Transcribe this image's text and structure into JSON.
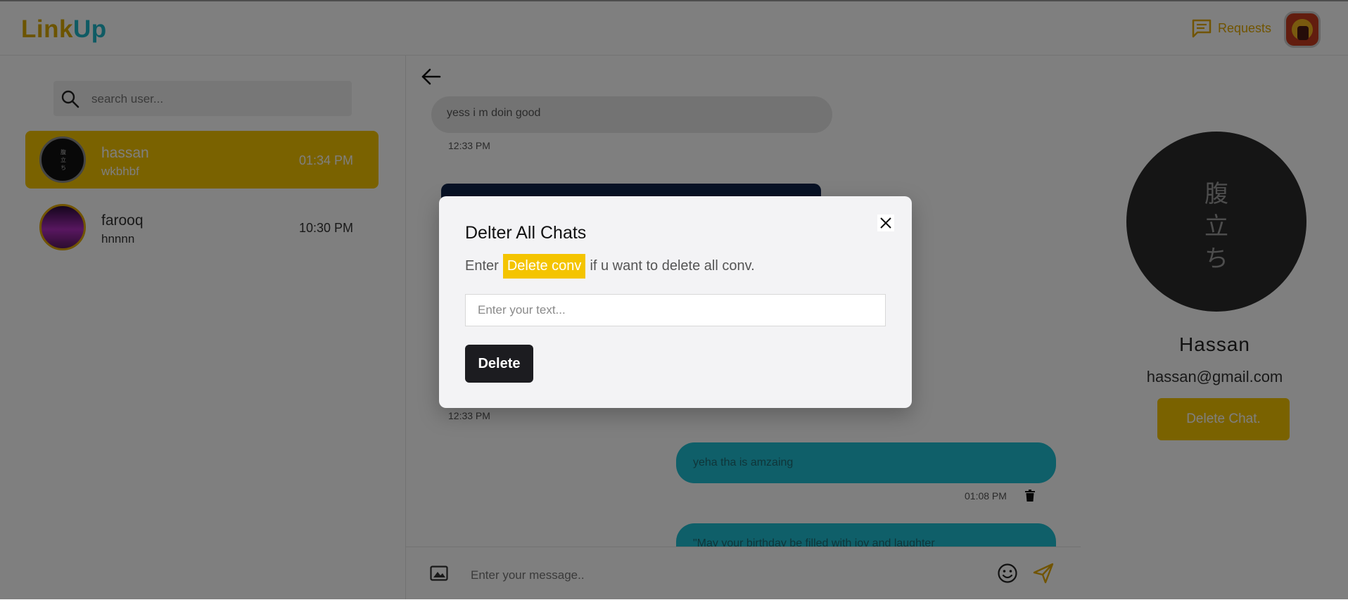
{
  "app": {
    "logo_part1": "Link",
    "logo_part2": "Up"
  },
  "header": {
    "requests_label": "Requests"
  },
  "sidebar": {
    "search_placeholder": "search user...",
    "contacts": [
      {
        "name": "hassan",
        "preview": "wkbhbf",
        "time": "01:34 PM",
        "active": true
      },
      {
        "name": "farooq",
        "preview": "hnnnn",
        "time": "10:30 PM",
        "active": false
      }
    ]
  },
  "chat": {
    "messages": [
      {
        "type": "received",
        "text": "yess i m doin good",
        "time": "12:33 PM"
      },
      {
        "type": "received",
        "text": "",
        "time": "12:33 PM"
      },
      {
        "type": "sent",
        "text": "yeha tha is amzaing",
        "time": "01:08 PM"
      },
      {
        "type": "sent",
        "text": "\"May your birthday be filled with joy and laughter",
        "time": ""
      }
    ],
    "composer_placeholder": "Enter your message.."
  },
  "profile": {
    "name": "Hassan",
    "email": "hassan@gmail.com",
    "delete_chat_label": "Delete Chat.",
    "avatar_text": "腹立ち"
  },
  "modal": {
    "title": "Delter All Chats",
    "desc_before": "Enter",
    "desc_highlight": "Delete conv",
    "desc_after": "if u want to delete all conv.",
    "input_placeholder": "Enter your text...",
    "delete_label": "Delete"
  },
  "colors": {
    "accent_yellow": "#f4c400",
    "accent_cyan": "#1ebfd2",
    "overlay": "rgba(0,0,0,0.5)"
  }
}
